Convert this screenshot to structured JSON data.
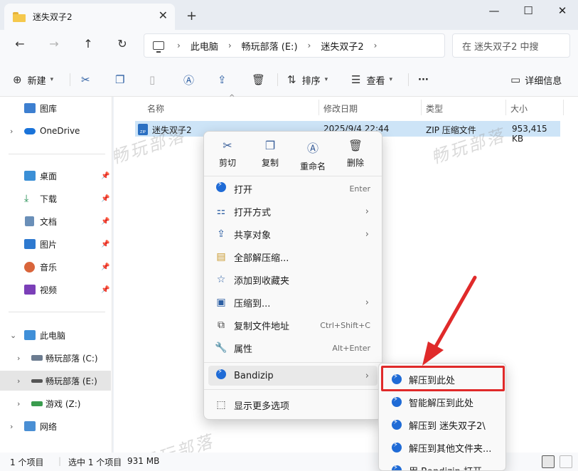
{
  "window": {
    "tab_title": "迷失双子2",
    "new_tab": "+",
    "close_tab": "✕",
    "minimize": "—",
    "maximize": "☐",
    "close": "✕"
  },
  "nav": {
    "back": "←",
    "forward": "→",
    "up": "↑",
    "refresh": "↻",
    "breadcrumb": [
      "此电脑",
      "畅玩部落 (E:)",
      "迷失双子2"
    ],
    "search_placeholder": "在 迷失双子2 中搜"
  },
  "toolbar": {
    "new": "新建",
    "sort": "排序",
    "view": "查看",
    "more": "···",
    "details": "详细信息"
  },
  "sidebar": {
    "gallery": "图库",
    "onedrive": "OneDrive",
    "quick": [
      "桌面",
      "下载",
      "文档",
      "图片",
      "音乐",
      "视频"
    ],
    "this_pc": "此电脑",
    "drives": [
      "畅玩部落 (C:)",
      "畅玩部落 (E:)",
      "游戏 (Z:)"
    ],
    "network": "网络"
  },
  "columns": {
    "name": "名称",
    "modified": "修改日期",
    "type": "类型",
    "size": "大小"
  },
  "file": {
    "name": "迷失双子2",
    "modified": "2025/9/4 22:44",
    "type": "ZIP 压缩文件",
    "size": "953,415 KB"
  },
  "watermark": "畅玩部落",
  "status": {
    "items": "1 个项目",
    "selected": "选中 1 个项目",
    "size": "931 MB"
  },
  "context_menu": {
    "quick_actions": [
      "剪切",
      "复制",
      "重命名",
      "删除"
    ],
    "items": [
      {
        "label": "打开",
        "key": "Enter"
      },
      {
        "label": "打开方式",
        "key": ""
      },
      {
        "label": "共享对象",
        "key": ""
      },
      {
        "label": "全部解压缩...",
        "key": ""
      },
      {
        "label": "添加到收藏夹",
        "key": ""
      },
      {
        "label": "压缩到...",
        "key": ""
      },
      {
        "label": "复制文件地址",
        "key": "Ctrl+Shift+C"
      },
      {
        "label": "属性",
        "key": "Alt+Enter"
      },
      {
        "label": "Bandizip",
        "key": ""
      },
      {
        "label": "显示更多选项",
        "key": ""
      }
    ]
  },
  "submenu": {
    "items": [
      "解压到此处",
      "智能解压到此处",
      "解压到 迷失双子2\\",
      "解压到其他文件夹...",
      "用 Bandizip 打开"
    ]
  },
  "colors": {
    "accent": "#2d5fa3",
    "selection": "#cde4f7",
    "highlight_box": "#e02a2a",
    "bandizip": "#1f6bd6"
  }
}
